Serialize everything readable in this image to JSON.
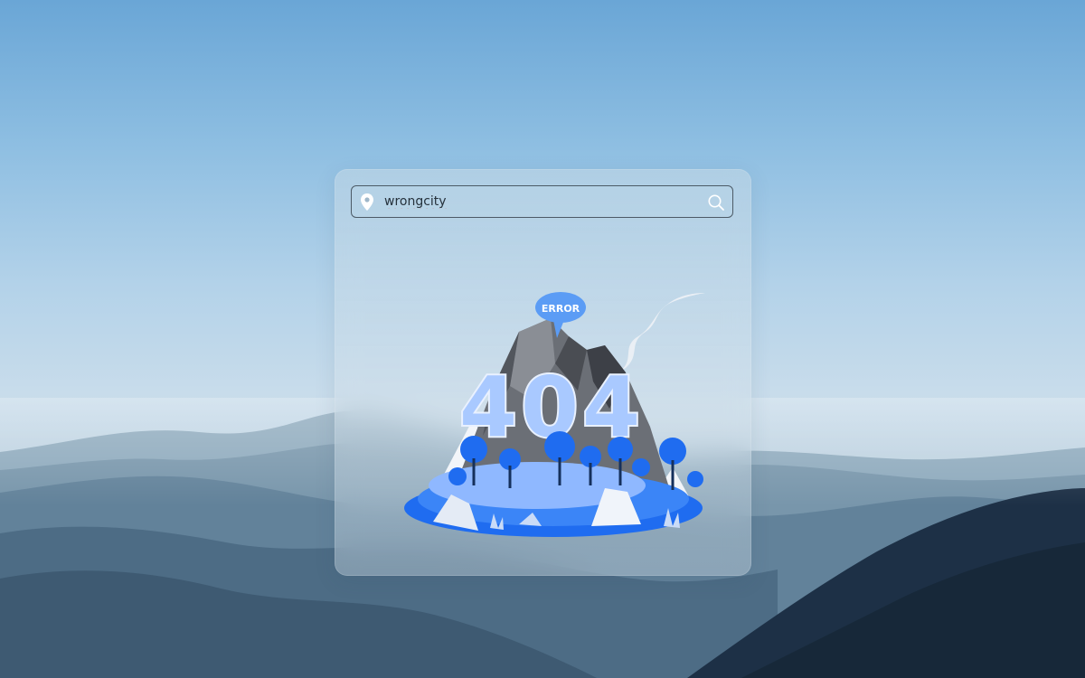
{
  "search": {
    "value": "wrongcity",
    "placeholder": ""
  },
  "icons": {
    "location": "map-pin-icon",
    "search": "search-icon"
  },
  "illustration": {
    "code_text": "404",
    "bubble_text": "ERROR",
    "name": "error-404-mountain-illustration"
  },
  "colors": {
    "accent_blue": "#1f6cf0",
    "light_blue": "#8fb8ff",
    "rock_gray": "#6b6f76",
    "search_border": "#4c5a66"
  }
}
